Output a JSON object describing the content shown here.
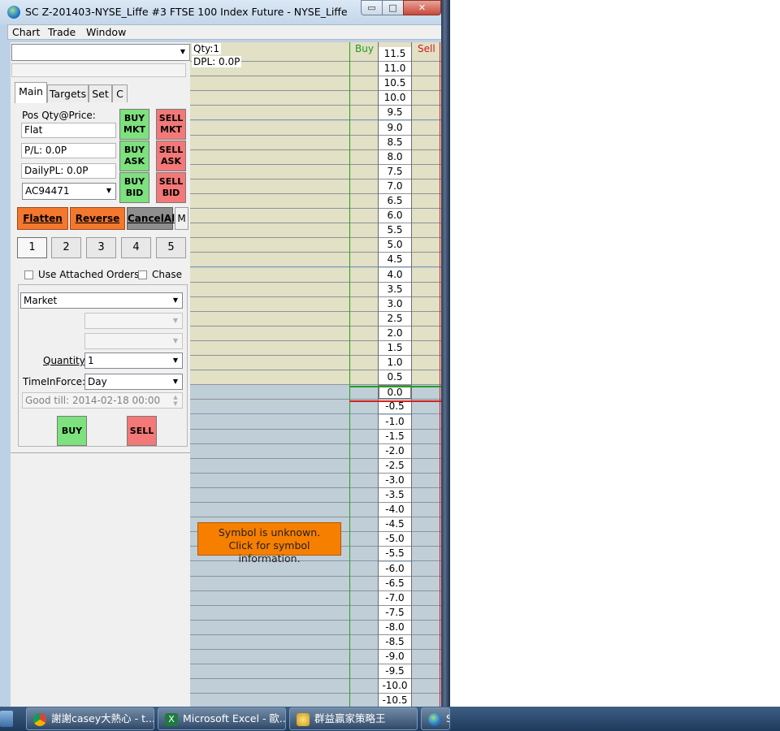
{
  "window": {
    "title": "SC Z-201403-NYSE_Liffe  #3  FTSE 100 Index Future - NYSE_Liffe",
    "min_glyph": "▭",
    "max_glyph": "□",
    "close_glyph": "✕"
  },
  "menu": {
    "items": [
      "Chart",
      "Trade",
      "Window"
    ]
  },
  "panel": {
    "symbol_value": "",
    "tabs": [
      "Main",
      "Targets",
      "Set",
      "C"
    ],
    "pos_label": "Pos Qty@Price:",
    "position_value": "Flat",
    "pl_value": "P/L: 0.0P",
    "daily_pl_value": "DailyPL: 0.0P",
    "account_value": "AC94471",
    "buttons": {
      "buy_mkt": "BUY\nMKT",
      "sell_mkt": "SELL\nMKT",
      "buy_ask": "BUY\nASK",
      "sell_ask": "SELL\nASK",
      "buy_bid": "BUY\nBID",
      "sell_bid": "SELL\nBID",
      "flatten": "Flatten",
      "reverse": "Reverse",
      "cancel_all": "CancelAll",
      "m": "M"
    },
    "quantity_presets": [
      "1",
      "2",
      "3",
      "4",
      "5"
    ],
    "use_attached_orders": "Use Attached Orders",
    "chase": "Chase",
    "order_type": "Market",
    "quantity_label": "Quantity:",
    "quantity_value": "1",
    "tif_label": "TimeInForce:",
    "tif_value": "Day",
    "good_till": "Good till: 2014-02-18 00:00",
    "buy": "BUY",
    "sell": "SELL"
  },
  "ladder": {
    "qty": "Qty:1",
    "dpl": "DPL: 0.0P",
    "buy_header": "Buy",
    "sell_header": "Sell",
    "prices": [
      "11.5",
      "11.0",
      "10.5",
      "10.0",
      "9.5",
      "9.0",
      "8.5",
      "8.0",
      "7.5",
      "7.0",
      "6.5",
      "6.0",
      "5.5",
      "5.0",
      "4.5",
      "4.0",
      "3.5",
      "3.0",
      "2.5",
      "2.0",
      "1.5",
      "1.0",
      "0.5",
      "0.0",
      "-0.5",
      "-1.0",
      "-1.5",
      "-2.0",
      "-2.5",
      "-3.0",
      "-3.5",
      "-4.0",
      "-4.5",
      "-5.0",
      "-5.5",
      "-6.0",
      "-6.5",
      "-7.0",
      "-7.5",
      "-8.0",
      "-8.5",
      "-9.0",
      "-9.5",
      "-10.0",
      "-10.5"
    ],
    "notice_line1": "Symbol is unknown.",
    "notice_line2": "Click for symbol information."
  },
  "taskbar": {
    "items": [
      {
        "label": "謝謝casey大熱心 - t..."
      },
      {
        "label": "Microsoft Excel - 歐..."
      },
      {
        "label": "群益贏家策略王"
      },
      {
        "label": "S"
      }
    ]
  },
  "colors": {
    "buy_green": "#7de17d",
    "sell_red": "#f47878",
    "orange": "#f4772e",
    "ladder_up": "#e2e0c5",
    "ladder_down": "#c0ced7"
  }
}
